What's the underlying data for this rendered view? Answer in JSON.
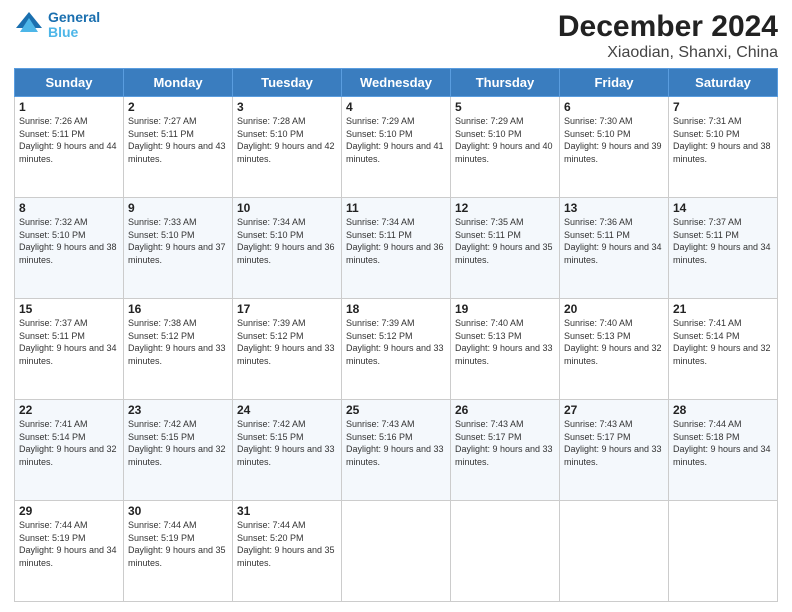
{
  "logo": {
    "line1": "General",
    "line2": "Blue"
  },
  "title": "December 2024",
  "subtitle": "Xiaodian, Shanxi, China",
  "days_header": [
    "Sunday",
    "Monday",
    "Tuesday",
    "Wednesday",
    "Thursday",
    "Friday",
    "Saturday"
  ],
  "weeks": [
    [
      {
        "day": "1",
        "sunrise": "Sunrise: 7:26 AM",
        "sunset": "Sunset: 5:11 PM",
        "daylight": "Daylight: 9 hours and 44 minutes."
      },
      {
        "day": "2",
        "sunrise": "Sunrise: 7:27 AM",
        "sunset": "Sunset: 5:11 PM",
        "daylight": "Daylight: 9 hours and 43 minutes."
      },
      {
        "day": "3",
        "sunrise": "Sunrise: 7:28 AM",
        "sunset": "Sunset: 5:10 PM",
        "daylight": "Daylight: 9 hours and 42 minutes."
      },
      {
        "day": "4",
        "sunrise": "Sunrise: 7:29 AM",
        "sunset": "Sunset: 5:10 PM",
        "daylight": "Daylight: 9 hours and 41 minutes."
      },
      {
        "day": "5",
        "sunrise": "Sunrise: 7:29 AM",
        "sunset": "Sunset: 5:10 PM",
        "daylight": "Daylight: 9 hours and 40 minutes."
      },
      {
        "day": "6",
        "sunrise": "Sunrise: 7:30 AM",
        "sunset": "Sunset: 5:10 PM",
        "daylight": "Daylight: 9 hours and 39 minutes."
      },
      {
        "day": "7",
        "sunrise": "Sunrise: 7:31 AM",
        "sunset": "Sunset: 5:10 PM",
        "daylight": "Daylight: 9 hours and 38 minutes."
      }
    ],
    [
      {
        "day": "8",
        "sunrise": "Sunrise: 7:32 AM",
        "sunset": "Sunset: 5:10 PM",
        "daylight": "Daylight: 9 hours and 38 minutes."
      },
      {
        "day": "9",
        "sunrise": "Sunrise: 7:33 AM",
        "sunset": "Sunset: 5:10 PM",
        "daylight": "Daylight: 9 hours and 37 minutes."
      },
      {
        "day": "10",
        "sunrise": "Sunrise: 7:34 AM",
        "sunset": "Sunset: 5:10 PM",
        "daylight": "Daylight: 9 hours and 36 minutes."
      },
      {
        "day": "11",
        "sunrise": "Sunrise: 7:34 AM",
        "sunset": "Sunset: 5:11 PM",
        "daylight": "Daylight: 9 hours and 36 minutes."
      },
      {
        "day": "12",
        "sunrise": "Sunrise: 7:35 AM",
        "sunset": "Sunset: 5:11 PM",
        "daylight": "Daylight: 9 hours and 35 minutes."
      },
      {
        "day": "13",
        "sunrise": "Sunrise: 7:36 AM",
        "sunset": "Sunset: 5:11 PM",
        "daylight": "Daylight: 9 hours and 34 minutes."
      },
      {
        "day": "14",
        "sunrise": "Sunrise: 7:37 AM",
        "sunset": "Sunset: 5:11 PM",
        "daylight": "Daylight: 9 hours and 34 minutes."
      }
    ],
    [
      {
        "day": "15",
        "sunrise": "Sunrise: 7:37 AM",
        "sunset": "Sunset: 5:11 PM",
        "daylight": "Daylight: 9 hours and 34 minutes."
      },
      {
        "day": "16",
        "sunrise": "Sunrise: 7:38 AM",
        "sunset": "Sunset: 5:12 PM",
        "daylight": "Daylight: 9 hours and 33 minutes."
      },
      {
        "day": "17",
        "sunrise": "Sunrise: 7:39 AM",
        "sunset": "Sunset: 5:12 PM",
        "daylight": "Daylight: 9 hours and 33 minutes."
      },
      {
        "day": "18",
        "sunrise": "Sunrise: 7:39 AM",
        "sunset": "Sunset: 5:12 PM",
        "daylight": "Daylight: 9 hours and 33 minutes."
      },
      {
        "day": "19",
        "sunrise": "Sunrise: 7:40 AM",
        "sunset": "Sunset: 5:13 PM",
        "daylight": "Daylight: 9 hours and 33 minutes."
      },
      {
        "day": "20",
        "sunrise": "Sunrise: 7:40 AM",
        "sunset": "Sunset: 5:13 PM",
        "daylight": "Daylight: 9 hours and 32 minutes."
      },
      {
        "day": "21",
        "sunrise": "Sunrise: 7:41 AM",
        "sunset": "Sunset: 5:14 PM",
        "daylight": "Daylight: 9 hours and 32 minutes."
      }
    ],
    [
      {
        "day": "22",
        "sunrise": "Sunrise: 7:41 AM",
        "sunset": "Sunset: 5:14 PM",
        "daylight": "Daylight: 9 hours and 32 minutes."
      },
      {
        "day": "23",
        "sunrise": "Sunrise: 7:42 AM",
        "sunset": "Sunset: 5:15 PM",
        "daylight": "Daylight: 9 hours and 32 minutes."
      },
      {
        "day": "24",
        "sunrise": "Sunrise: 7:42 AM",
        "sunset": "Sunset: 5:15 PM",
        "daylight": "Daylight: 9 hours and 33 minutes."
      },
      {
        "day": "25",
        "sunrise": "Sunrise: 7:43 AM",
        "sunset": "Sunset: 5:16 PM",
        "daylight": "Daylight: 9 hours and 33 minutes."
      },
      {
        "day": "26",
        "sunrise": "Sunrise: 7:43 AM",
        "sunset": "Sunset: 5:17 PM",
        "daylight": "Daylight: 9 hours and 33 minutes."
      },
      {
        "day": "27",
        "sunrise": "Sunrise: 7:43 AM",
        "sunset": "Sunset: 5:17 PM",
        "daylight": "Daylight: 9 hours and 33 minutes."
      },
      {
        "day": "28",
        "sunrise": "Sunrise: 7:44 AM",
        "sunset": "Sunset: 5:18 PM",
        "daylight": "Daylight: 9 hours and 34 minutes."
      }
    ],
    [
      {
        "day": "29",
        "sunrise": "Sunrise: 7:44 AM",
        "sunset": "Sunset: 5:19 PM",
        "daylight": "Daylight: 9 hours and 34 minutes."
      },
      {
        "day": "30",
        "sunrise": "Sunrise: 7:44 AM",
        "sunset": "Sunset: 5:19 PM",
        "daylight": "Daylight: 9 hours and 35 minutes."
      },
      {
        "day": "31",
        "sunrise": "Sunrise: 7:44 AM",
        "sunset": "Sunset: 5:20 PM",
        "daylight": "Daylight: 9 hours and 35 minutes."
      },
      null,
      null,
      null,
      null
    ]
  ]
}
